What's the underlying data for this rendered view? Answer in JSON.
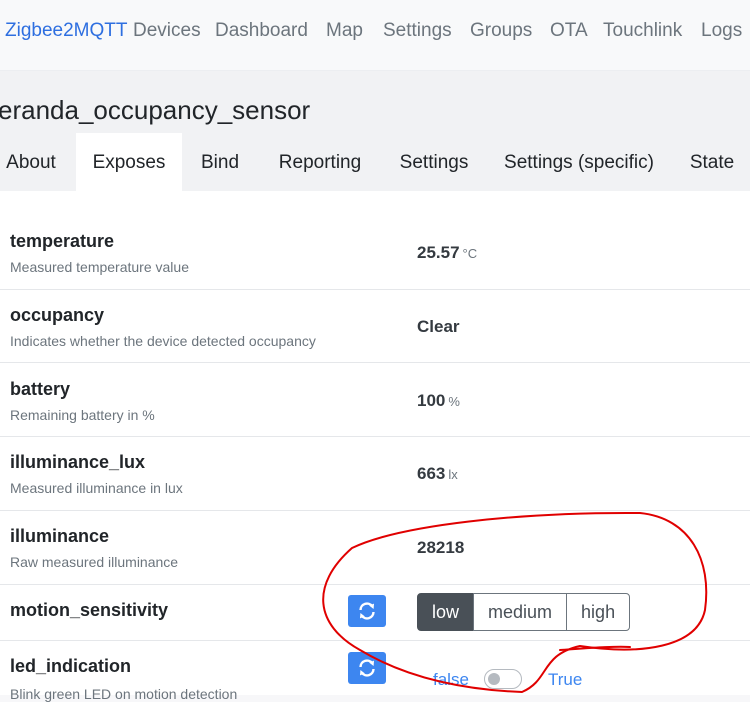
{
  "nav": {
    "brand": "Zigbee2MQTT",
    "links": [
      "Devices",
      "Dashboard",
      "Map",
      "Settings",
      "Groups",
      "OTA",
      "Touchlink",
      "Logs"
    ]
  },
  "device": {
    "title": "eranda_occupancy_sensor"
  },
  "tabs": [
    "About",
    "Exposes",
    "Bind",
    "Reporting",
    "Settings",
    "Settings (specific)",
    "State"
  ],
  "active_tab": "Exposes",
  "exposes": [
    {
      "name": "temperature",
      "description": "Measured temperature value",
      "value": "25.57",
      "unit": "°C"
    },
    {
      "name": "occupancy",
      "description": "Indicates whether the device detected occupancy",
      "value": "Clear",
      "unit": ""
    },
    {
      "name": "battery",
      "description": "Remaining battery in %",
      "value": "100",
      "unit": "%"
    },
    {
      "name": "illuminance_lux",
      "description": "Measured illuminance in lux",
      "value": "663",
      "unit": "lx"
    },
    {
      "name": "illuminance",
      "description": "Raw measured illuminance",
      "value": "28218",
      "unit": ""
    }
  ],
  "motion_sensitivity": {
    "name": "motion_sensitivity",
    "options": [
      "low",
      "medium",
      "high"
    ],
    "selected": "low",
    "refresh_icon": "refresh-icon"
  },
  "led_indication": {
    "name": "led_indication",
    "description": "Blink green LED on motion detection",
    "false_label": "false",
    "true_label": "True",
    "value": false,
    "refresh_icon": "refresh-icon"
  },
  "colors": {
    "brand": "#2e6fe0",
    "button_primary": "#3d86f0",
    "selected_option": "#495057",
    "annotation": "#e00000"
  }
}
